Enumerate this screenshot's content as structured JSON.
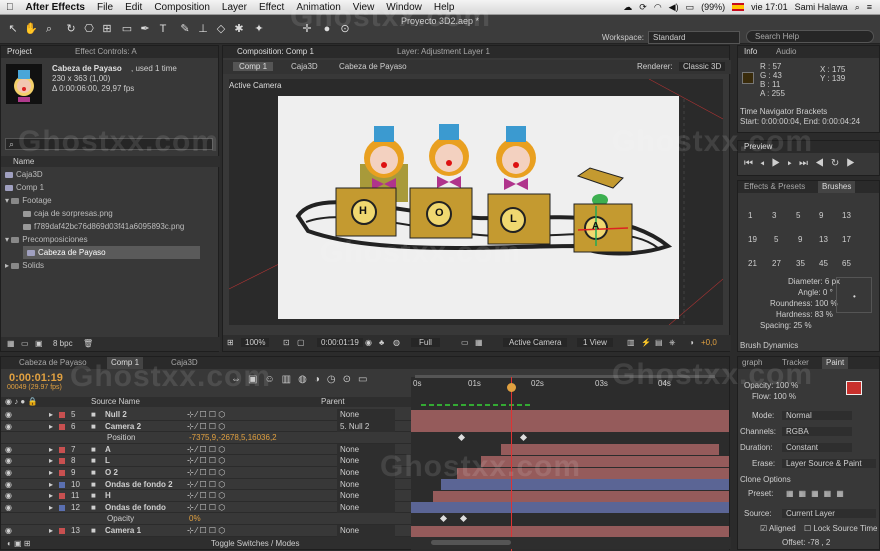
{
  "menubar": {
    "apple": "",
    "app": "After Effects",
    "items": [
      "File",
      "Edit",
      "Composition",
      "Layer",
      "Effect",
      "Animation",
      "View",
      "Window",
      "Help"
    ],
    "battery": "(99%)",
    "clock": "vie 17:01",
    "user": "Sami Halawa"
  },
  "toolbar": {
    "title": "Proyecto 3D2.aep *",
    "workspace_label": "Workspace:",
    "workspace_value": "Standard",
    "search_placeholder": "Search Help"
  },
  "project": {
    "tab": "Project",
    "tab2": "Effect Controls: A",
    "item_name": "Cabeza de Payaso",
    "item_used": ", used 1 time",
    "item_size": "230 x 363 (1,00)",
    "item_duration": "Δ 0:00:06:00, 29,97 fps",
    "col_name": "Name",
    "rows": [
      "Caja3D",
      "Comp 1",
      "Footage",
      "caja de sorpresas.png",
      "f789daf42bc76d869d03f41a6095893c.png",
      "Precomposiciones",
      "Cabeza de Payaso",
      "Solids"
    ],
    "bpc": "8 bpc"
  },
  "viewer": {
    "tab": "Composition: Comp 1",
    "tab2": "Layer: Adjustment Layer 1",
    "crumbs": [
      "Comp 1",
      "Caja3D",
      "Cabeza de Payaso"
    ],
    "renderer_label": "Renderer:",
    "renderer": "Classic 3D",
    "active_camera": "Active Camera",
    "zoom": "100%",
    "timecode": "0:00:01:19",
    "resolution": "Full",
    "camera": "Active Camera",
    "view": "1 View",
    "exposure": "+0,0",
    "letters": [
      "H",
      "O",
      "L",
      "A"
    ]
  },
  "timeline": {
    "tabs": [
      "Cabeza de Payaso",
      "Comp 1",
      "Caja3D"
    ],
    "timecode": "0:00:01:19",
    "frames": "00049 (29.97 fps)",
    "col_source": "Source Name",
    "col_parent": "Parent",
    "ticks": [
      "0s",
      "01s",
      "02s",
      "03s",
      "04s"
    ],
    "toggle": "Toggle Switches / Modes",
    "layers": [
      {
        "num": "5",
        "name": "Null 2",
        "parent": "None",
        "color": "#c85050"
      },
      {
        "num": "6",
        "name": "Camera 2",
        "parent": "5. Null 2",
        "color": "#c85050"
      },
      {
        "num": "",
        "name": "Position",
        "value": "-7375,9,-2678,5,16036,2",
        "parent": "",
        "color": ""
      },
      {
        "num": "7",
        "name": "A",
        "parent": "None",
        "color": "#c85050"
      },
      {
        "num": "8",
        "name": "L",
        "parent": "None",
        "color": "#c85050"
      },
      {
        "num": "9",
        "name": "O 2",
        "parent": "None",
        "color": "#c85050"
      },
      {
        "num": "10",
        "name": "Ondas de fondo 2",
        "parent": "None",
        "color": "#5a6fb0"
      },
      {
        "num": "11",
        "name": "H",
        "parent": "None",
        "color": "#c85050"
      },
      {
        "num": "12",
        "name": "Ondas de fondo",
        "parent": "None",
        "color": "#5a6fb0"
      },
      {
        "num": "",
        "name": "Opacity",
        "value": "0%",
        "parent": "",
        "color": ""
      },
      {
        "num": "13",
        "name": "Camera 1",
        "parent": "None",
        "color": "#c85050"
      }
    ]
  },
  "info": {
    "tab": "Info",
    "tab2": "Audio",
    "r": "R : 57",
    "g": "G : 43",
    "b": "B : 11",
    "a": "A : 255",
    "x": "X : 175",
    "y": "Y : 139",
    "nav": "Time Navigator Brackets",
    "range": "Start: 0:00:00:04, End: 0:00:04:24"
  },
  "preview": {
    "tab": "Preview"
  },
  "brushes": {
    "tab": "Effects & Presets",
    "tab2": "Brushes",
    "sizes": [
      "1",
      "3",
      "5",
      "9",
      "13",
      "19",
      "5",
      "9",
      "13",
      "17",
      "21",
      "27",
      "35",
      "45",
      "65"
    ],
    "diameter": "Diameter: 6 px",
    "angle": "Angle: 0 °",
    "roundness": "Roundness: 100 %",
    "hardness": "Hardness: 83 %",
    "spacing": "Spacing: 25 %",
    "dynamics": "Brush Dynamics"
  },
  "paint": {
    "tabs": [
      "graph",
      "Tracker",
      "Paint"
    ],
    "opacity": "Opacity: 100 %",
    "flow": "Flow: 100 %",
    "mode_label": "Mode:",
    "mode": "Normal",
    "channels_label": "Channels:",
    "channels": "RGBA",
    "duration_label": "Duration:",
    "duration": "Constant",
    "erase_label": "Erase:",
    "erase": "Layer Source & Paint",
    "clone": "Clone Options",
    "preset": "Preset:",
    "source_label": "Source:",
    "source": "Current Layer",
    "aligned": "Aligned",
    "lock": "Lock Source Time",
    "offset": "Offset: -78 , 2"
  },
  "watermark": "Ghostxx.com"
}
